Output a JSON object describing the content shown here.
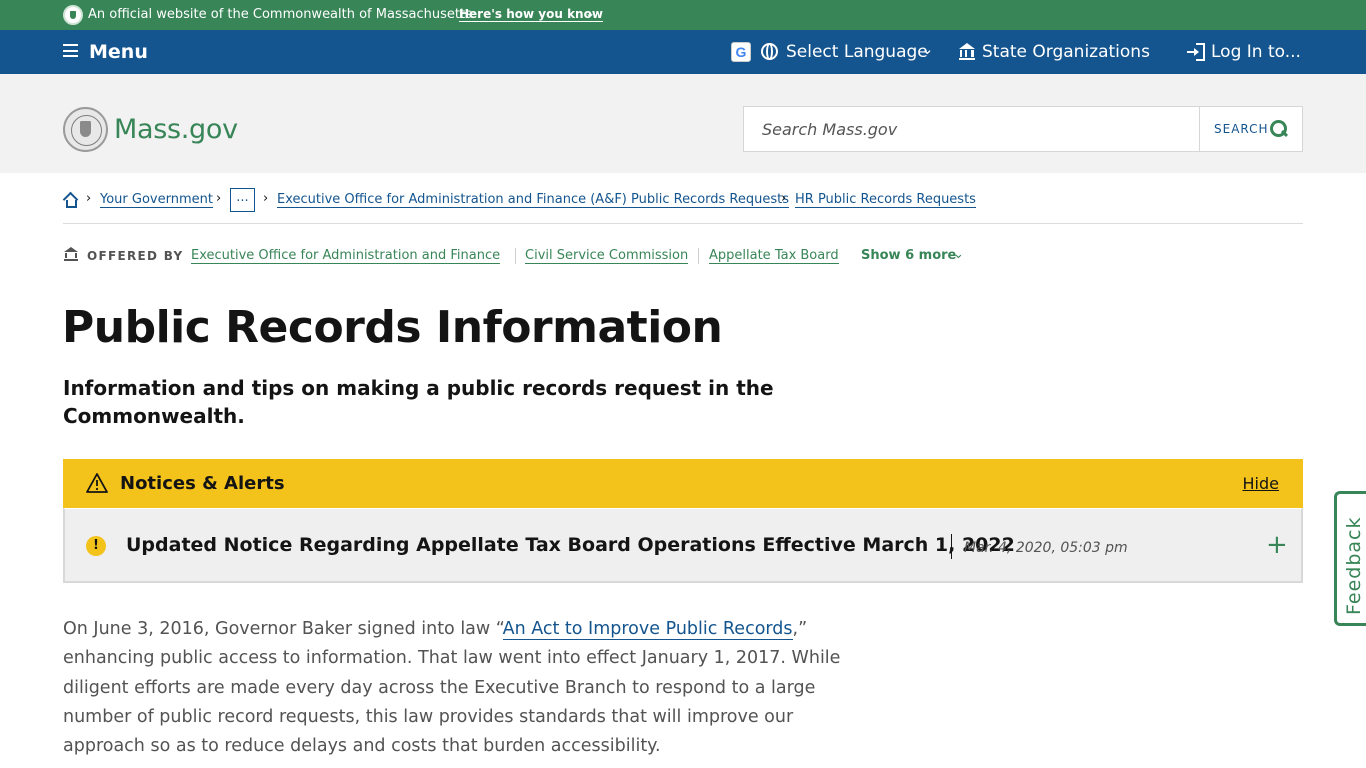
{
  "official_bar": {
    "text": "An official website of the Commonwealth of Massachusetts",
    "howto_label": "Here's how you know",
    "howto_icon": "chevron-down-icon"
  },
  "nav": {
    "menu_label": "Menu",
    "language_label": "Select Language",
    "state_orgs_label": "State Organizations",
    "login_label": "Log In to..."
  },
  "header": {
    "logo_text": "Mass.gov",
    "search": {
      "placeholder": "Search Mass.gov",
      "button_label": "SEARCH"
    }
  },
  "breadcrumb": {
    "items": [
      "Your Government",
      "...",
      "Executive Office for Administration and Finance (A&F) Public Records Requests",
      "HR Public Records Requests"
    ]
  },
  "offered_by": {
    "label": "OFFERED BY",
    "orgs": [
      "Executive Office for Administration and Finance",
      "Civil Service Commission",
      "Appellate Tax Board"
    ],
    "show_more": "Show 6 more"
  },
  "page": {
    "title": "Public Records Information",
    "subtitle": "Information and tips on making a public records request in the Commonwealth."
  },
  "alerts": {
    "title": "Notices & Alerts",
    "hide_label": "Hide",
    "item": {
      "icon_text": "!",
      "headline": "Updated Notice Regarding Appellate Tax Board Operations Effective March 1, 2022",
      "date": "Mar. 4, 2020, 05:03 pm",
      "expand_label": "+"
    }
  },
  "body": {
    "prefix": "On June 3, 2016, Governor Baker signed into law “",
    "link": "An Act to Improve Public Records",
    "suffix": ",” enhancing public access to information.  That law went into effect January 1, 2017.  While diligent efforts are made every day across the Executive Branch to respond to a large number of public record requests, this law provides standards that will improve our approach so as to reduce delays and costs that burden accessibility."
  },
  "feedback": {
    "label": "Feedback"
  },
  "colors": {
    "green": "#388557",
    "blue": "#14558f",
    "alert_yellow": "#f3c31b",
    "header_gray": "#f2f2f2"
  }
}
